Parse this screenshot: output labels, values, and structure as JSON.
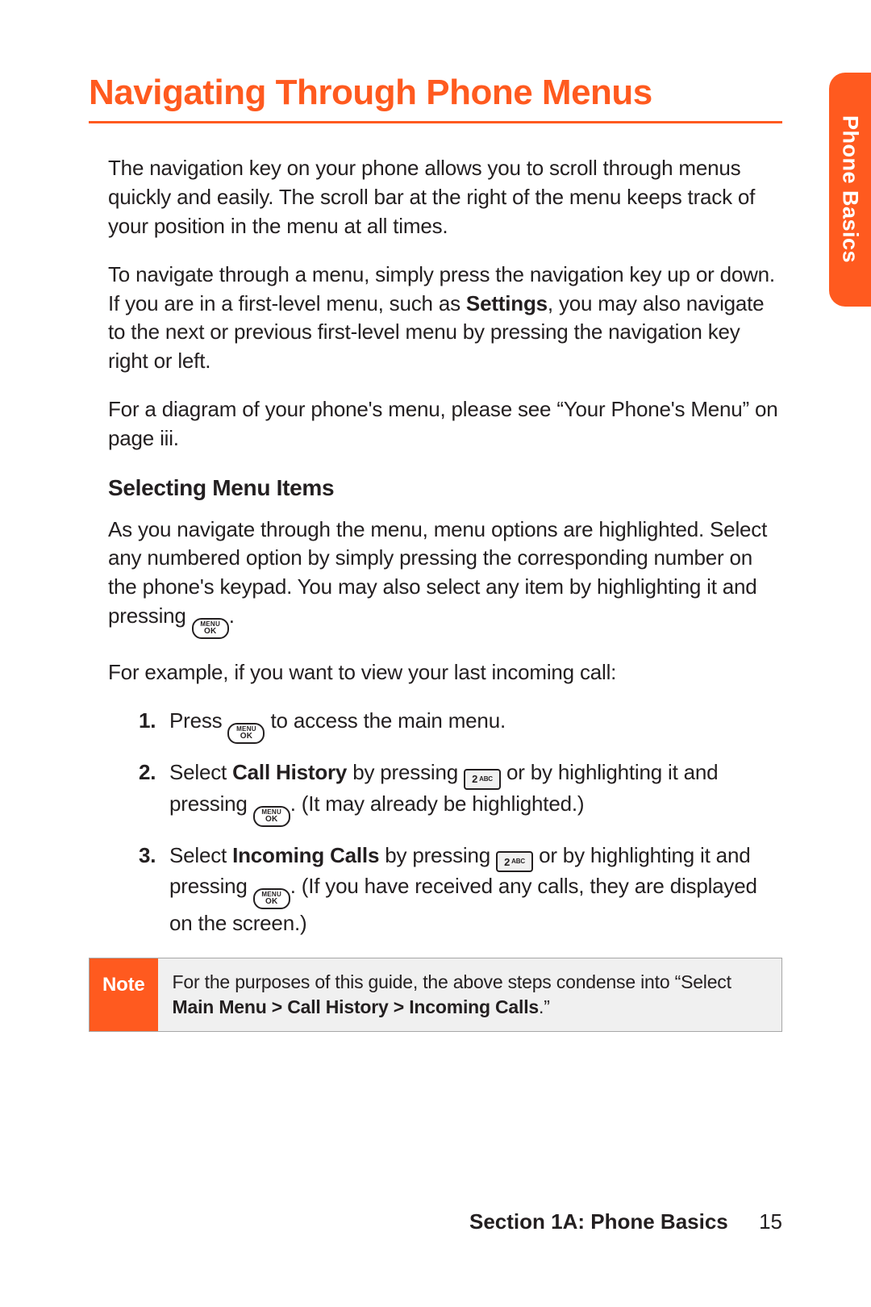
{
  "side_tab": "Phone Basics",
  "title": "Navigating Through Phone Menus",
  "paras": {
    "p1": "The navigation key on your phone allows you to scroll through menus quickly and easily. The scroll bar at the right of the menu keeps track of your position in the menu at all times.",
    "p2a": "To navigate through a menu, simply press the navigation key up or down. If you are in a first-level menu, such as ",
    "p2_bold": "Settings",
    "p2b": ", you may also navigate to the next or previous first-level menu by pressing the navigation key right or left.",
    "p3": "For a diagram of your phone's menu, please see “Your Phone's Menu” on page iii."
  },
  "subhead": "Selecting Menu Items",
  "select": {
    "p4a": "As you navigate through the menu, menu options are highlighted. Select any numbered option by simply pressing the corresponding number on the phone's keypad. You may also select any item by highlighting it and pressing ",
    "p4b": ".",
    "p5": "For example, if you want to view your last incoming call:"
  },
  "steps": {
    "s1a": "Press ",
    "s1b": " to access the main menu.",
    "s2a": "Select ",
    "s2_bold": "Call History",
    "s2b": " by pressing ",
    "s2c": " or by highlighting it and pressing ",
    "s2d": ". (It may already be highlighted.)",
    "s3a": "Select ",
    "s3_bold": "Incoming Calls",
    "s3b": " by pressing ",
    "s3c": " or by highlighting it and pressing ",
    "s3d": ". (If you have received any calls, they are displayed on the screen.)"
  },
  "keys": {
    "menu_top": "MENU",
    "menu_bot": "OK",
    "two_digit": "2",
    "two_abc": "ABC"
  },
  "note": {
    "label": "Note",
    "body_a": "For the purposes of this guide, the above steps condense into “Select ",
    "body_bold": "Main Menu > Call History > Incoming Calls",
    "body_b": ".”"
  },
  "footer": {
    "section": "Section 1A: Phone Basics",
    "page": "15"
  }
}
